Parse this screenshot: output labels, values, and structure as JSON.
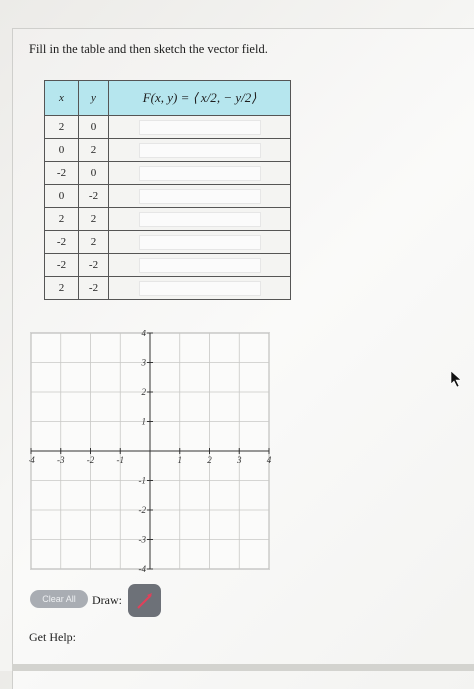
{
  "prompt": "Fill in the table and then sketch the vector field.",
  "table": {
    "headers": {
      "x": "x",
      "y": "y",
      "f_prefix": "F(x, y) = ⟨",
      "f_c1": "x/2",
      "f_comma": ",",
      "f_c2": "− y/2",
      "f_suffix": "⟩"
    },
    "rows": [
      {
        "x": "2",
        "y": "0"
      },
      {
        "x": "0",
        "y": "2"
      },
      {
        "x": "-2",
        "y": "0"
      },
      {
        "x": "0",
        "y": "-2"
      },
      {
        "x": "2",
        "y": "2"
      },
      {
        "x": "-2",
        "y": "2"
      },
      {
        "x": "-2",
        "y": "-2"
      },
      {
        "x": "2",
        "y": "-2"
      }
    ]
  },
  "graph": {
    "x_ticks": [
      "-4",
      "-3",
      "-2",
      "-1",
      "1",
      "2",
      "3",
      "4"
    ],
    "y_ticks": [
      "4",
      "3",
      "2",
      "1",
      "-1",
      "-2",
      "-3",
      "-4"
    ]
  },
  "controls": {
    "clear_label": "Clear All",
    "draw_label": "Draw:",
    "help_label": "Get Help:"
  },
  "colors": {
    "header_bg": "#b6e6ee",
    "draw_tool": "#6d7178",
    "arrow": "#e0405a"
  },
  "icons": {
    "draw_tool": "arrow-pen-icon",
    "cursor": "mouse-pointer-icon"
  }
}
